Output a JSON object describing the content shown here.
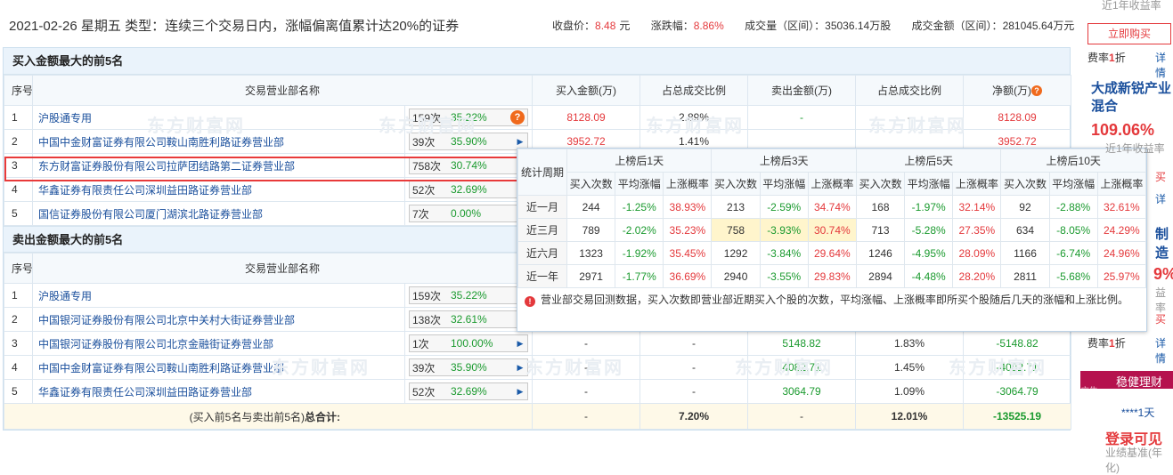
{
  "header": {
    "title": "2021-02-26 星期五  类型：连续三个交易日内，涨幅偏离值累计达20%的证券",
    "close_label": "收盘价：",
    "close_value": "8.48",
    "unit_yuan": "元",
    "change_label": "涨跌幅：",
    "change_value": "8.86%",
    "volume_label": "成交量（区间）：",
    "volume_value": "35036.14万股",
    "amount_label": "成交金额（区间）：",
    "amount_value": "281045.64万元"
  },
  "buy_section": {
    "title": "买入金额最大的前5名",
    "columns": [
      "序号",
      "交易营业部名称",
      "买入金额(万)",
      "占总成交比例",
      "卖出金额(万)",
      "占总成交比例",
      "净额(万)"
    ],
    "rows": [
      {
        "no": "1",
        "name": "沪股通专用",
        "cnt": "159次",
        "pct": "35.22%",
        "icon": "question-icon",
        "buy": "8128.09",
        "buy_ratio": "2.89%",
        "sell": "-",
        "sell_ratio": "-",
        "net": "8128.09"
      },
      {
        "no": "2",
        "name": "中国中金财富证券有限公司鞍山南胜利路证券营业部",
        "cnt": "39次",
        "pct": "35.90%",
        "icon": "arrow-right-icon",
        "buy": "3952.72",
        "buy_ratio": "1.41%",
        "sell": "",
        "sell_ratio": "",
        "net": "3952.72"
      },
      {
        "no": "3",
        "name": "东方财富证券股份有限公司拉萨团结路第二证券营业部",
        "cnt": "758次",
        "pct": "30.74%",
        "icon": "arrow-right-icon",
        "buy": "",
        "buy_ratio": "",
        "sell": "",
        "sell_ratio": "",
        "net": ""
      },
      {
        "no": "4",
        "name": "华鑫证券有限责任公司深圳益田路证券营业部",
        "cnt": "52次",
        "pct": "32.69%",
        "icon": "arrow-right-icon",
        "buy": "",
        "buy_ratio": "",
        "sell": "",
        "sell_ratio": "",
        "net": ""
      },
      {
        "no": "5",
        "name": "国信证券股份有限公司厦门湖滨北路证券营业部",
        "cnt": "7次",
        "pct": "0.00%",
        "icon": "arrow-right-icon",
        "buy": "",
        "buy_ratio": "",
        "sell": "",
        "sell_ratio": "",
        "net": ""
      }
    ]
  },
  "sell_section": {
    "title": "卖出金额最大的前5名",
    "columns": [
      "序号",
      "交易营业部名称"
    ],
    "rows": [
      {
        "no": "1",
        "name": "沪股通专用",
        "cnt": "159次",
        "pct": "35.22%",
        "buy": "",
        "buy_ratio": "",
        "sell": "",
        "sell_ratio": "",
        "net": ""
      },
      {
        "no": "2",
        "name": "中国银河证券股份有限公司北京中关村大街证券营业部",
        "cnt": "138次",
        "pct": "32.61%",
        "buy": "",
        "buy_ratio": "",
        "sell": "",
        "sell_ratio": "",
        "net": ""
      },
      {
        "no": "3",
        "name": "中国银河证券股份有限公司北京金融街证券营业部",
        "cnt": "1次",
        "pct": "100.00%",
        "buy": "-",
        "buy_ratio": "-",
        "sell": "5148.82",
        "sell_ratio": "1.83%",
        "net": "-5148.82"
      },
      {
        "no": "4",
        "name": "中国中金财富证券有限公司鞍山南胜利路证券营业部",
        "cnt": "39次",
        "pct": "35.90%",
        "buy": "-",
        "buy_ratio": "-",
        "sell": "4082.71",
        "sell_ratio": "1.45%",
        "net": "-4082.71"
      },
      {
        "no": "5",
        "name": "华鑫证券有限责任公司深圳益田路证券营业部",
        "cnt": "52次",
        "pct": "32.69%",
        "buy": "-",
        "buy_ratio": "-",
        "sell": "3064.79",
        "sell_ratio": "1.09%",
        "net": "-3064.79"
      }
    ],
    "total": {
      "label": "(买入前5名与卖出前5名)",
      "label_bold": "总合计:",
      "buy": "-",
      "buy_ratio": "7.20%",
      "sell": "-",
      "sell_ratio": "12.01%",
      "net": "-13525.19"
    }
  },
  "popup": {
    "period_header": "统计周期",
    "groups": [
      "上榜后1天",
      "上榜后3天",
      "上榜后5天",
      "上榜后10天"
    ],
    "subcols": [
      "买入次数",
      "平均涨幅",
      "上涨概率"
    ],
    "rows": [
      {
        "period": "近一月",
        "vals": [
          "244",
          "-1.25%",
          "38.93%",
          "213",
          "-2.59%",
          "34.74%",
          "168",
          "-1.97%",
          "32.14%",
          "92",
          "-2.88%",
          "32.61%"
        ]
      },
      {
        "period": "近三月",
        "vals": [
          "789",
          "-2.02%",
          "35.23%",
          "758",
          "-3.93%",
          "30.74%",
          "713",
          "-5.28%",
          "27.35%",
          "634",
          "-8.05%",
          "24.29%"
        ]
      },
      {
        "period": "近六月",
        "vals": [
          "1323",
          "-1.92%",
          "35.45%",
          "1292",
          "-3.84%",
          "29.64%",
          "1246",
          "-4.95%",
          "28.09%",
          "1166",
          "-6.74%",
          "24.96%"
        ]
      },
      {
        "period": "近一年",
        "vals": [
          "2971",
          "-1.77%",
          "36.69%",
          "2940",
          "-3.55%",
          "29.83%",
          "2894",
          "-4.48%",
          "28.20%",
          "2811",
          "-5.68%",
          "25.97%"
        ]
      }
    ],
    "note": "营业部交易回测数据，买入次数即营业部近期买入个股的次数，平均涨幅、上涨概率即所买个股随后几天的涨幅和上涨比例。"
  },
  "sidebar": {
    "yield_label": "近1年收益率",
    "buy_button": "立即购买",
    "fee_label": "费率",
    "fee_value": "1",
    "fee_suffix": "折",
    "detail_link": "详情",
    "fund_name": "大成新锐产业混合",
    "fund_return": "109.06%",
    "fund_return_label": "近1年收益率",
    "partial_buy": "买",
    "partial_detail": "详",
    "partial_manufacturing": "制造",
    "partial_pct": "9%",
    "partial_yield": "益率",
    "partial_buy2": "买",
    "fee2_label": "费率",
    "fee2_value": "1",
    "fee2_suffix": "折",
    "detail2_link": "详情",
    "ad_label": "广告",
    "ad_text": "稳健理财",
    "day_text": "****1天",
    "login_text": "登录可见",
    "perf_text": "业绩基准(年化)"
  },
  "watermark": {
    "text": "东方财富网",
    "sub": "eastmoney.com"
  }
}
